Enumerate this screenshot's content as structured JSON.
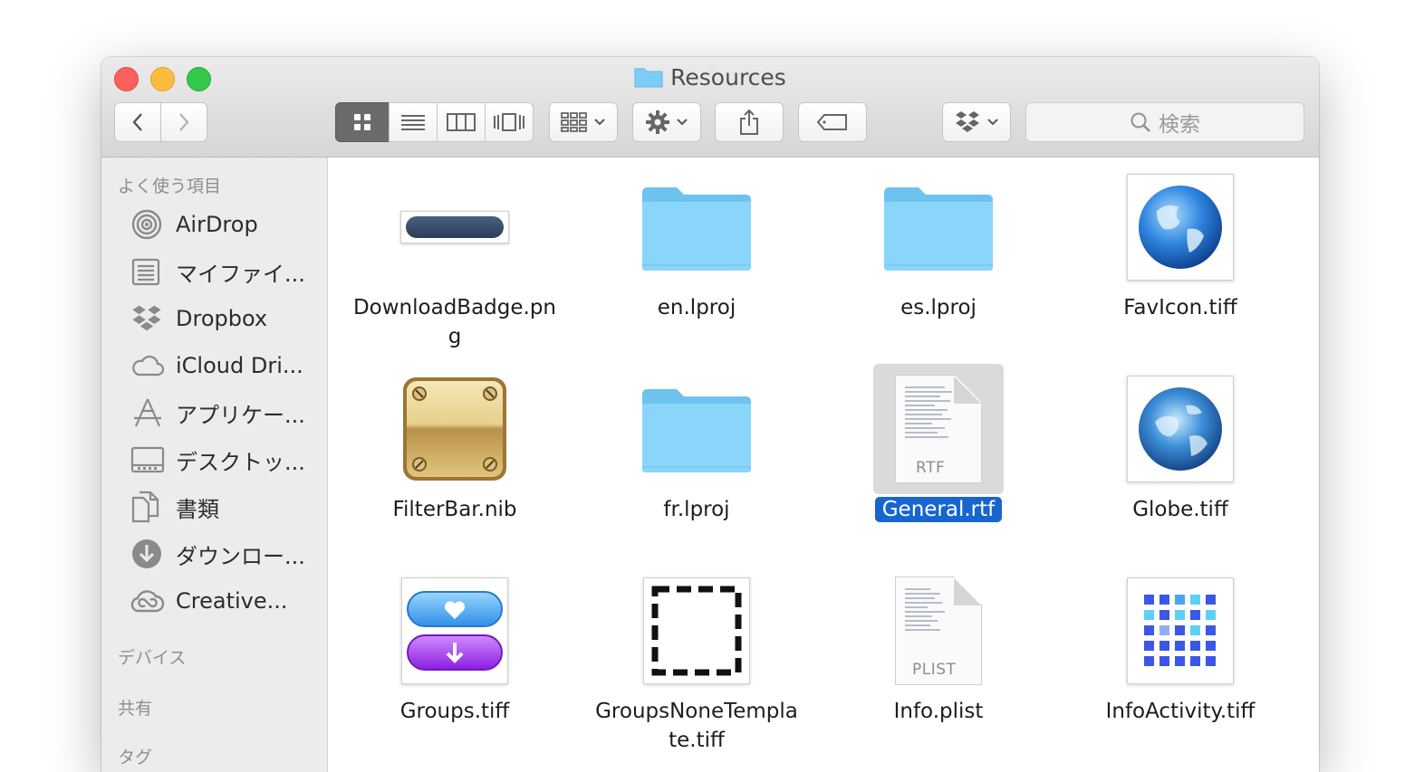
{
  "window": {
    "title": "Resources"
  },
  "toolbar": {
    "back_icon": "chevron-left-icon",
    "forward_icon": "chevron-right-icon",
    "view_modes": [
      "icon-view",
      "list-view",
      "column-view",
      "cover-flow-view"
    ],
    "arrange_icon": "arrange-grid-icon",
    "action_icon": "gear-icon",
    "share_icon": "share-icon",
    "tag_icon": "tag-icon",
    "dropbox_icon": "dropbox-icon",
    "search_placeholder": "検索"
  },
  "sidebar": {
    "favorites_header": "よく使う項目",
    "items": [
      {
        "label": "AirDrop",
        "icon": "airdrop-icon"
      },
      {
        "label": "マイファイ...",
        "icon": "all-files-icon"
      },
      {
        "label": "Dropbox",
        "icon": "dropbox-icon"
      },
      {
        "label": "iCloud Dri...",
        "icon": "cloud-icon"
      },
      {
        "label": "アプリケー...",
        "icon": "applications-icon"
      },
      {
        "label": "デスクトッ...",
        "icon": "desktop-icon"
      },
      {
        "label": "書類",
        "icon": "documents-icon"
      },
      {
        "label": "ダウンロー...",
        "icon": "downloads-icon"
      },
      {
        "label": "Creative...",
        "icon": "creative-cloud-icon"
      }
    ],
    "devices_header": "デバイス",
    "shared_header": "共有",
    "tags_header": "タグ"
  },
  "files": [
    {
      "name": "DownloadBadge.pn\ng",
      "icon": "badge-image-icon"
    },
    {
      "name": "en.lproj",
      "icon": "folder-icon"
    },
    {
      "name": "es.lproj",
      "icon": "folder-icon"
    },
    {
      "name": "FavIcon.tiff",
      "icon": "globe-icon"
    },
    {
      "name": "FilterBar.nib",
      "icon": "nib-icon"
    },
    {
      "name": "fr.lproj",
      "icon": "folder-icon"
    },
    {
      "name": "General.rtf",
      "icon": "rtf-document-icon",
      "selected": true,
      "tag": "RTF"
    },
    {
      "name": "Globe.tiff",
      "icon": "globe-icon"
    },
    {
      "name": "Groups.tiff",
      "icon": "groups-image-icon"
    },
    {
      "name": "GroupsNoneTempla\nte.tiff",
      "icon": "dashed-square-icon"
    },
    {
      "name": "Info.plist",
      "icon": "plist-document-icon",
      "tag": "PLIST"
    },
    {
      "name": "InfoActivity.tiff",
      "icon": "activity-grid-icon"
    }
  ],
  "colors": {
    "selection": "#1865d0",
    "folder": "#7ccdf6",
    "close": "#fc605c",
    "minimize": "#fdbc40",
    "maximize": "#34c84a"
  }
}
